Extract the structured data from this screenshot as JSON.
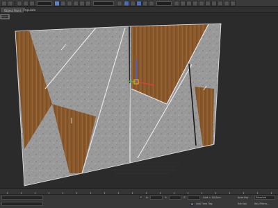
{
  "tabs": [
    {
      "label": "Object Paint",
      "active": true
    },
    {
      "label": "Populate",
      "active": false
    }
  ],
  "viewport": {
    "colors": {
      "background": "#2b2b2b",
      "wood": "#8a5a2e",
      "stone": "#9a9a9a",
      "edge": "#e8e8e8",
      "gizmo_x": "#d94040",
      "gizmo_y": "#40c040",
      "gizmo_z": "#4060e0",
      "gizmo_center": "#e0c020"
    }
  },
  "statusbar": {
    "x_label": "X:",
    "y_label": "Y:",
    "z_label": "Z:",
    "grid_label": "Grid = 10,0cm",
    "add_time_tag": "Add Time Tag",
    "auto_key_label": "Auto Key",
    "selected_value": "Selected",
    "set_key_label": "Set Key",
    "key_filters": "Key Filters..."
  }
}
